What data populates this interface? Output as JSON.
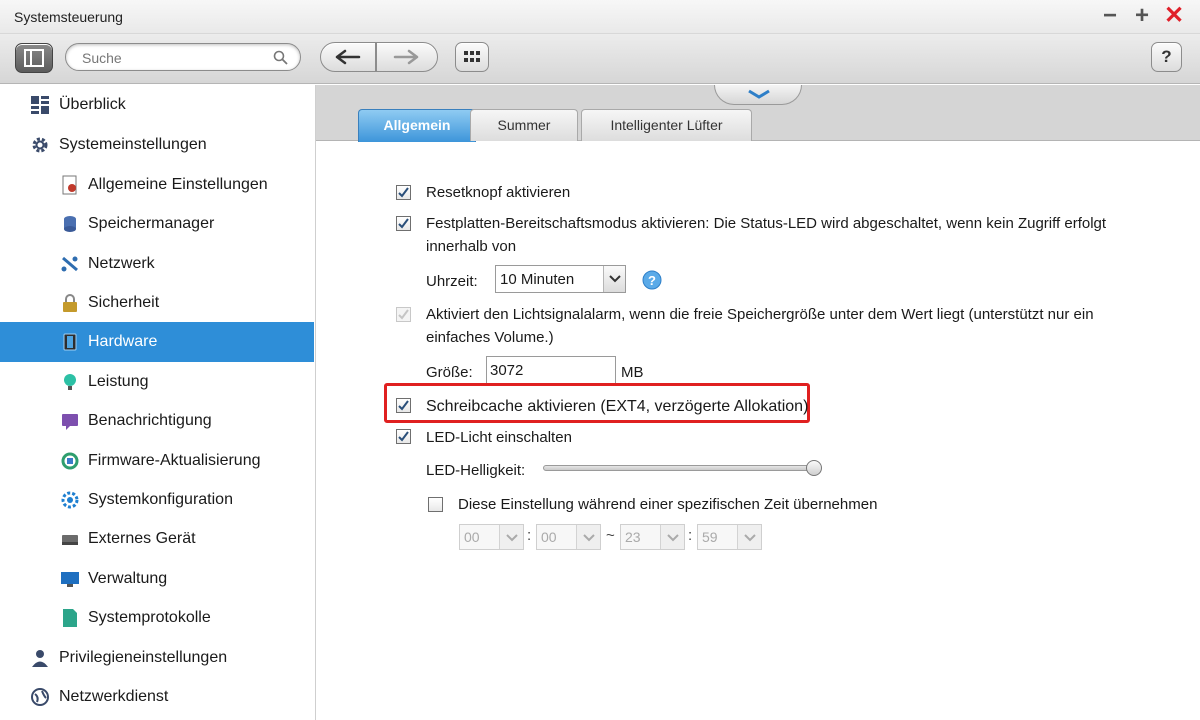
{
  "window": {
    "title": "Systemsteuerung",
    "minimize_glyph": "−",
    "maximize_glyph": "+",
    "close_glyph": "✕",
    "help_label": "?"
  },
  "toolbar": {
    "search_placeholder": "Suche",
    "back_icon": "arrow-left-icon",
    "forward_icon": "arrow-right-icon",
    "apps_icon": "grid-icon"
  },
  "sidebar": {
    "items": [
      {
        "label": "Überblick",
        "level": 0,
        "icon": "overview-icon"
      },
      {
        "label": "Systemeinstellungen",
        "level": 0,
        "icon": "gear-icon"
      },
      {
        "label": "Allgemeine Einstellungen",
        "level": 1,
        "icon": "settings-doc-icon"
      },
      {
        "label": "Speichermanager",
        "level": 1,
        "icon": "storage-icon"
      },
      {
        "label": "Netzwerk",
        "level": 1,
        "icon": "network-icon"
      },
      {
        "label": "Sicherheit",
        "level": 1,
        "icon": "lock-icon"
      },
      {
        "label": "Hardware",
        "level": 1,
        "icon": "hardware-icon",
        "selected": true
      },
      {
        "label": "Leistung",
        "level": 1,
        "icon": "bulb-icon"
      },
      {
        "label": "Benachrichtigung",
        "level": 1,
        "icon": "notification-icon"
      },
      {
        "label": "Firmware-Aktualisierung",
        "level": 1,
        "icon": "firmware-icon"
      },
      {
        "label": "Systemkonfiguration",
        "level": 1,
        "icon": "sysconfig-icon"
      },
      {
        "label": "Externes Gerät",
        "level": 1,
        "icon": "external-device-icon"
      },
      {
        "label": "Verwaltung",
        "level": 1,
        "icon": "monitor-icon"
      },
      {
        "label": "Systemprotokolle",
        "level": 1,
        "icon": "log-icon"
      },
      {
        "label": "Privilegieneinstellungen",
        "level": 0,
        "icon": "user-icon"
      },
      {
        "label": "Netzwerkdienst",
        "level": 0,
        "icon": "globe-icon"
      }
    ]
  },
  "tabs": [
    {
      "label": "Allgemein",
      "active": true
    },
    {
      "label": "Summer",
      "active": false
    },
    {
      "label": "Intelligenter Lüfter",
      "active": false
    }
  ],
  "settings": {
    "reset_button": {
      "label": "Resetknopf aktivieren",
      "checked": true
    },
    "standby": {
      "label": "Festplatten-Bereitschaftsmodus aktivieren: Die Status-LED wird abgeschaltet, wenn kein Zugriff erfolgt innerhalb von",
      "checked": true
    },
    "standby_time": {
      "label": "Uhrzeit:",
      "value": "10 Minuten"
    },
    "light_alarm": {
      "label": "Aktiviert den Lichtsignalalarm, wenn die freie Speichergröße unter dem Wert liegt (unterstützt nur ein einfaches Volume.)",
      "checked": true,
      "disabled": true
    },
    "size": {
      "label": "Größe:",
      "value": "3072",
      "unit": "MB"
    },
    "write_cache": {
      "label": "Schreibcache aktivieren (EXT4, verzögerte Allokation)",
      "checked": true,
      "highlight_color": "#e02020"
    },
    "led": {
      "label": "LED-Licht einschalten",
      "checked": true
    },
    "led_brightness": {
      "label": "LED-Helligkeit:",
      "level": 1.0
    },
    "schedule": {
      "label": "Diese Einstellung während einer spezifischen Zeit übernehmen",
      "checked": false
    },
    "time_range": {
      "start_hour": "00",
      "start_min": "00",
      "end_hour": "23",
      "end_min": "59",
      "colon": ":",
      "tilde": "~"
    }
  },
  "colors": {
    "accent": "#2e8ed8",
    "highlight": "#e02020"
  }
}
